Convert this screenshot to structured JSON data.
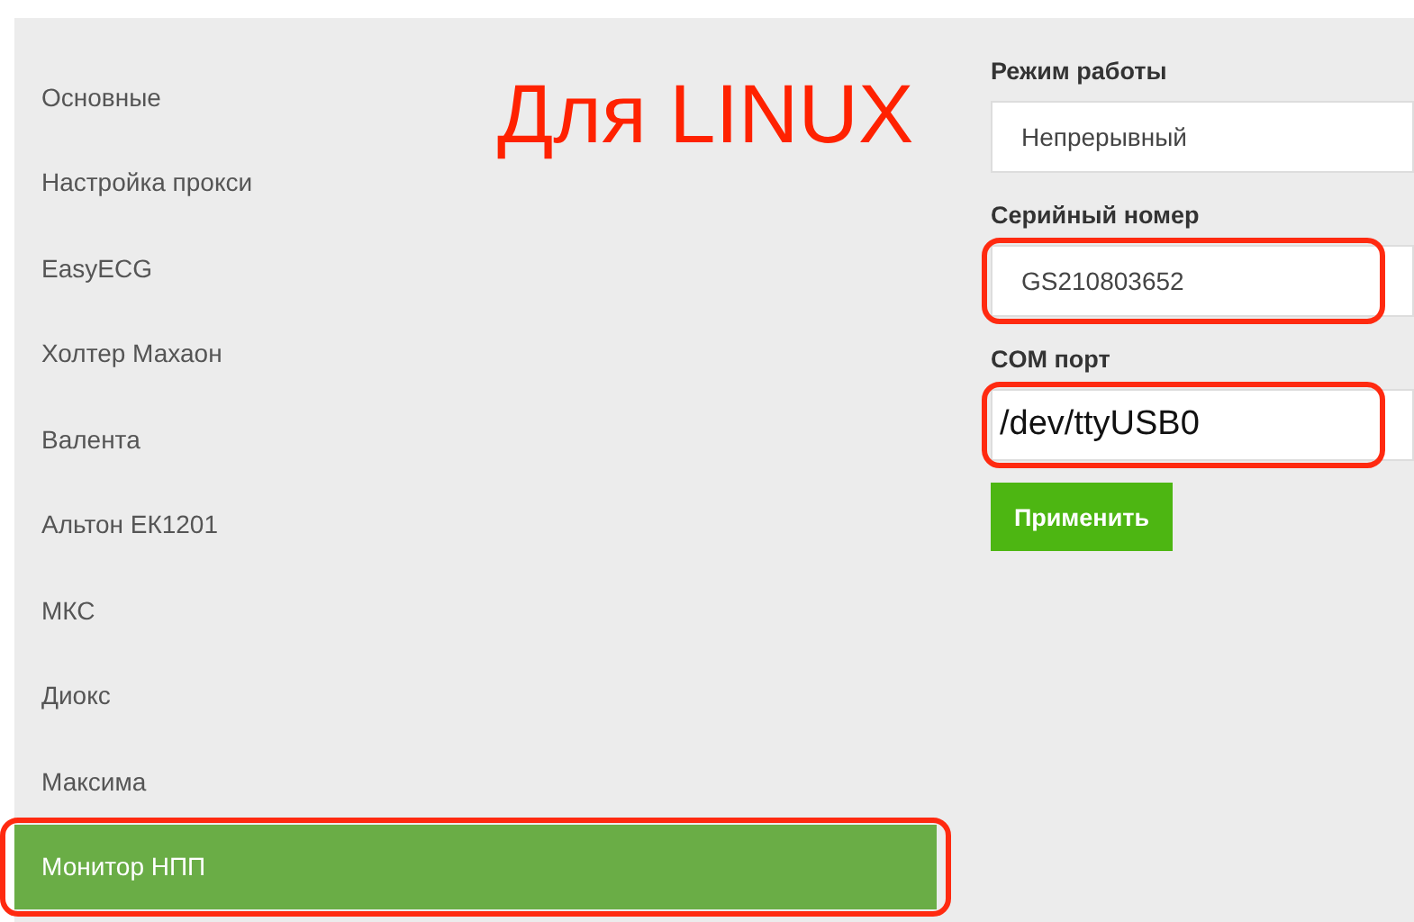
{
  "sidebar": {
    "items": [
      {
        "label": "Основные",
        "selected": false,
        "highlighted": false
      },
      {
        "label": "Настройка прокси",
        "selected": false,
        "highlighted": false
      },
      {
        "label": "EasyECG",
        "selected": false,
        "highlighted": false
      },
      {
        "label": "Холтер Махаон",
        "selected": false,
        "highlighted": false
      },
      {
        "label": "Валента",
        "selected": false,
        "highlighted": false
      },
      {
        "label": "Альтон ЕК1201",
        "selected": false,
        "highlighted": false
      },
      {
        "label": "МКС",
        "selected": false,
        "highlighted": false
      },
      {
        "label": "Диокс",
        "selected": false,
        "highlighted": false
      },
      {
        "label": "Максима",
        "selected": false,
        "highlighted": false
      },
      {
        "label": "Монитор НПП",
        "selected": true,
        "highlighted": true
      }
    ]
  },
  "annotation": {
    "text": "Для LINUX"
  },
  "form": {
    "fields": [
      {
        "label": "Режим работы",
        "value": "Непрерывный",
        "highlighted": false,
        "emphasis": false
      },
      {
        "label": "Серийный номер",
        "value": "GS210803652",
        "highlighted": true,
        "emphasis": false
      },
      {
        "label": "COM порт",
        "value": "/dev/ttyUSB0",
        "highlighted": true,
        "emphasis": true
      }
    ],
    "button": "Применить"
  }
}
